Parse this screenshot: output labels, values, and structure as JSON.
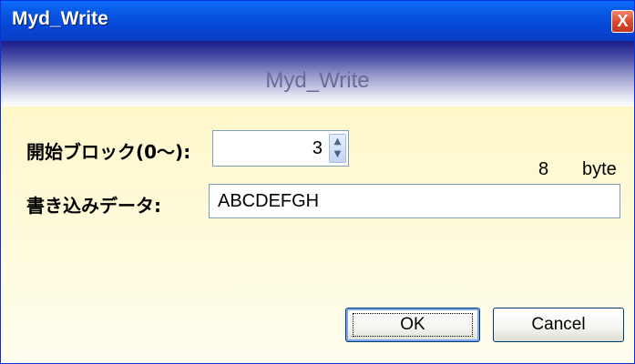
{
  "window": {
    "title": "Myd_Write",
    "close_label": "X"
  },
  "header": {
    "title": "Myd_Write"
  },
  "form": {
    "start_block_label": "開始ブロック(0〜):",
    "start_block_value": "3",
    "byte_count": "8",
    "byte_unit": "byte",
    "write_data_label": "書き込みデータ:",
    "write_data_value": "ABCDEFGH"
  },
  "buttons": {
    "ok_label": "OK",
    "cancel_label": "Cancel"
  },
  "icons": {
    "spin_up": "spin-up-icon",
    "spin_down": "spin-down-icon",
    "close": "close-icon"
  },
  "colors": {
    "titlebar": "#0548d8",
    "header_top": "#191c8a",
    "content_bg": "#fff7c9",
    "input_border": "#7f9db9"
  }
}
